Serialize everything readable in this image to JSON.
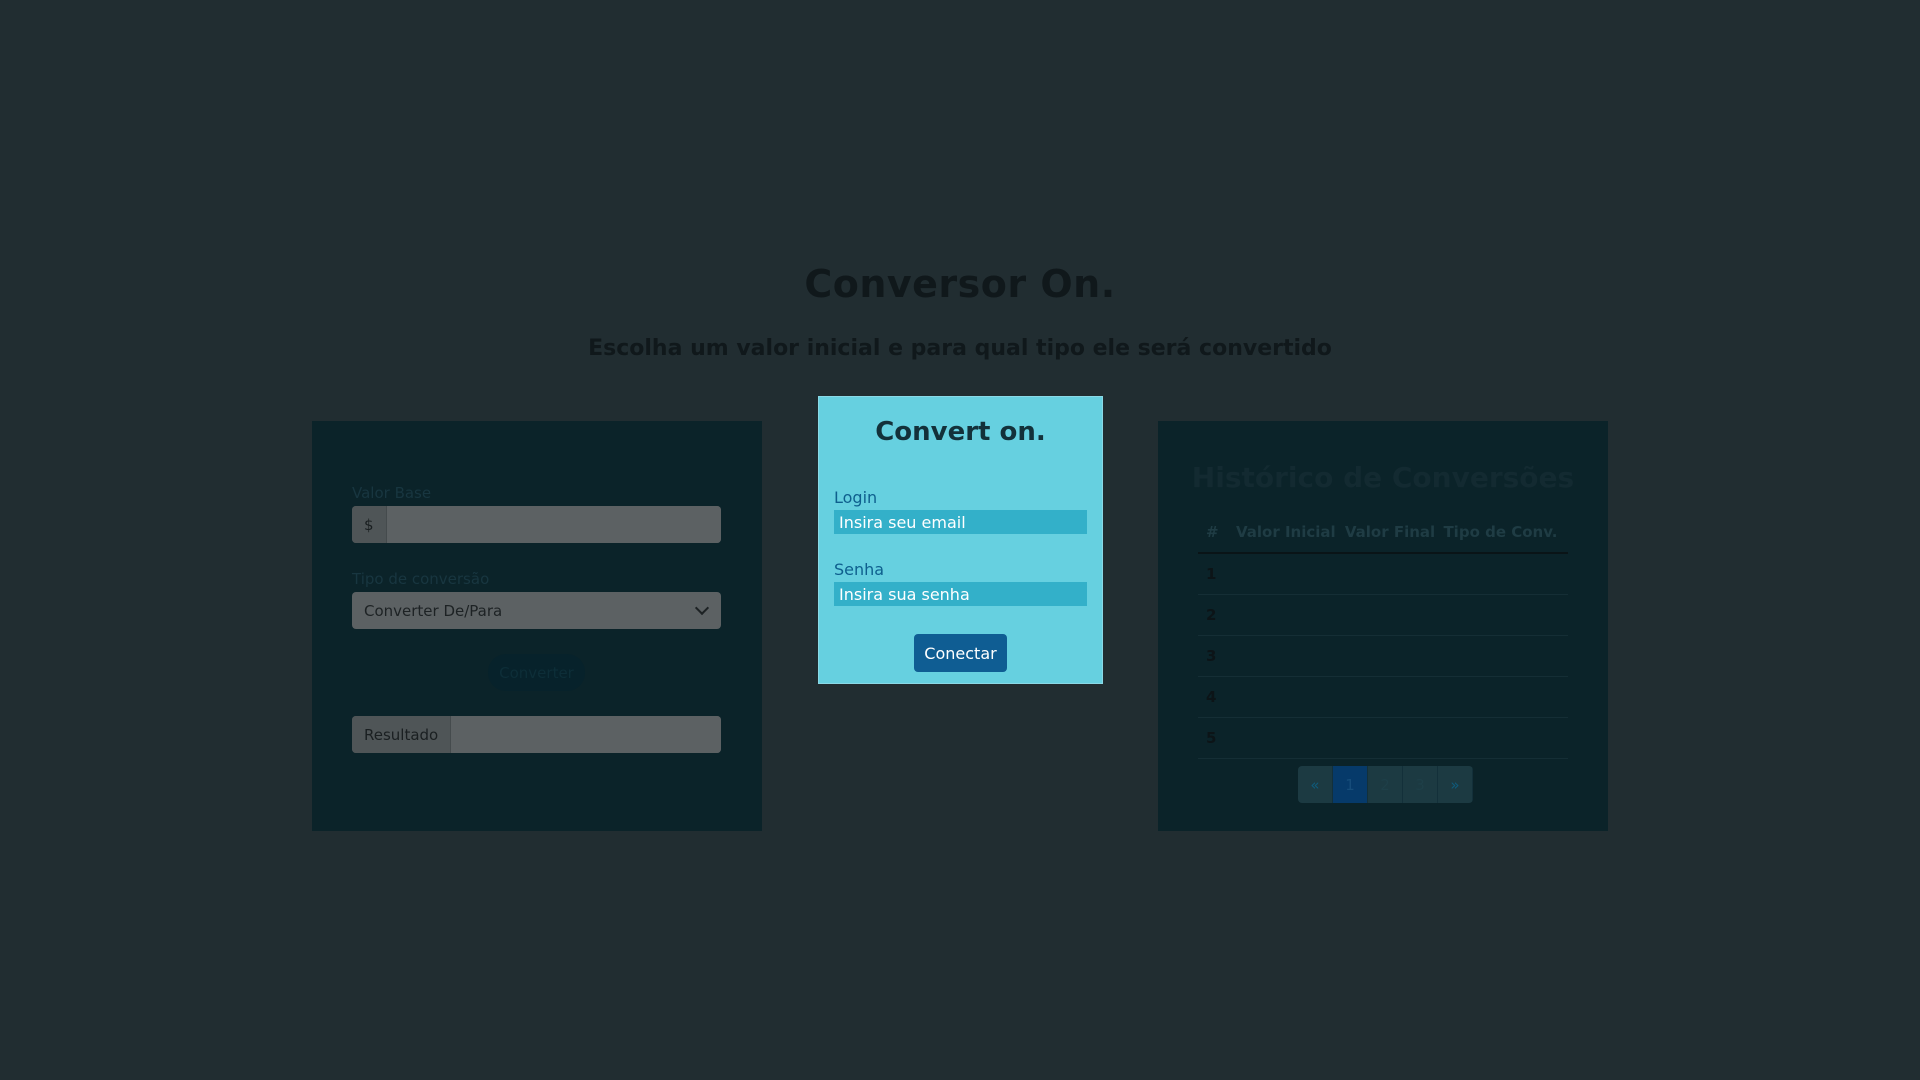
{
  "header": {
    "title": "Conversor On.",
    "subtitle": "Escolha um valor inicial e para qual tipo ele será convertido"
  },
  "converter": {
    "base_label": "Valor Base",
    "currency_prefix": "$",
    "base_value": "",
    "type_label": "Tipo de conversão",
    "type_selected": "Converter De/Para",
    "convert_button": "Converter",
    "result_label": "Resultado",
    "result_value": ""
  },
  "login_modal": {
    "title": "Convert on.",
    "login_label": "Login",
    "login_placeholder": "Insira seu email",
    "password_label": "Senha",
    "password_placeholder": "Insira sua senha",
    "connect_button": "Conectar"
  },
  "history": {
    "title": "Histórico de Conversões",
    "columns": [
      "#",
      "Valor Inicial",
      "Valor Final",
      "Tipo de Conv."
    ],
    "rows": [
      {
        "n": "1",
        "initial": "",
        "final": "",
        "type": ""
      },
      {
        "n": "2",
        "initial": "",
        "final": "",
        "type": ""
      },
      {
        "n": "3",
        "initial": "",
        "final": "",
        "type": ""
      },
      {
        "n": "4",
        "initial": "",
        "final": "",
        "type": ""
      },
      {
        "n": "5",
        "initial": "",
        "final": "",
        "type": ""
      }
    ],
    "pagination": {
      "prev": "«",
      "pages": [
        "1",
        "2",
        "3"
      ],
      "active_page": "1",
      "next": "»"
    }
  },
  "colors": {
    "background": "#212d31",
    "modal_bg": "#66d0e0",
    "modal_input_bg": "#33b0c9",
    "button_primary": "#0f5d93"
  }
}
